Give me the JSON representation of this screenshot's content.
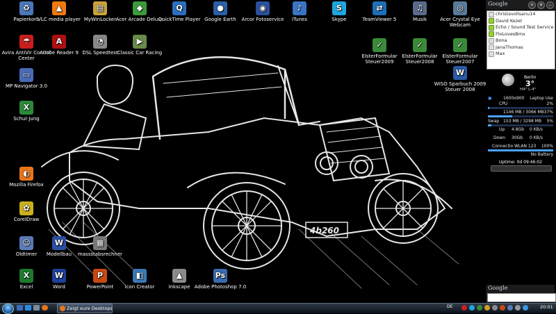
{
  "desktop_icons": [
    {
      "label": "Papierkorb",
      "icon": "recycle-bin-icon",
      "color": "#4a78b8"
    },
    {
      "label": "VLC media player",
      "icon": "vlc-cone-icon",
      "color": "#f07a10"
    },
    {
      "label": "MyWinLocker",
      "icon": "lock-icon",
      "color": "#c9a23a"
    },
    {
      "label": "Acer Arcade Deluxe",
      "icon": "arcade-icon",
      "color": "#3c9b3c"
    },
    {
      "label": "QuickTime Player",
      "icon": "quicktime-icon",
      "color": "#2b6fc2"
    },
    {
      "label": "Google Earth",
      "icon": "globe-icon",
      "color": "#2c5fa8"
    },
    {
      "label": "Arcor Fotoservice",
      "icon": "camera-badge-icon",
      "color": "#2a4f9e"
    },
    {
      "label": "iTunes",
      "icon": "music-note-icon",
      "color": "#3a74c4"
    },
    {
      "label": "Skype",
      "icon": "skype-icon",
      "color": "#1ea6e0"
    },
    {
      "label": "TeamViewer 5",
      "icon": "teamviewer-icon",
      "color": "#1c6fb8"
    },
    {
      "label": "Musik",
      "icon": "music-folder-icon",
      "color": "#5a6a8a"
    },
    {
      "label": "Acer Crystal Eye Webcam",
      "icon": "webcam-icon",
      "color": "#5a7a9a"
    },
    {
      "label": "Avira AntiVir Control Center",
      "icon": "umbrella-icon",
      "color": "#c81e1e"
    },
    {
      "label": "Adobe Reader 9",
      "icon": "pdf-icon",
      "color": "#b01010"
    },
    {
      "label": "DSL Speedtest",
      "icon": "speedometer-icon",
      "color": "#888888"
    },
    {
      "label": "Classic Car Racing",
      "icon": "racing-car-icon",
      "color": "#6a8a4a"
    },
    {
      "label": "ElsterFormular Steuer2009",
      "icon": "tax-form-icon",
      "color": "#3a8a3a"
    },
    {
      "label": "ElsterFormular Steuer2008",
      "icon": "tax-form-icon",
      "color": "#3a8a3a"
    },
    {
      "label": "ElsterFormular Steuer2007",
      "icon": "tax-form-icon",
      "color": "#3a8a3a"
    },
    {
      "label": "MP Navigator 3.0",
      "icon": "scanner-icon",
      "color": "#4a6ab8"
    },
    {
      "label": "WISO Sparbuch 2009 Steuer 2008",
      "icon": "wiso-icon",
      "color": "#2a5aa8"
    },
    {
      "label": "Schul-Jung",
      "icon": "excel-doc-icon",
      "color": "#2a8a3a"
    },
    {
      "label": "Mozilla Firefox",
      "icon": "firefox-icon",
      "color": "#e8741c"
    },
    {
      "label": "CorelDraw",
      "icon": "coreldraw-icon",
      "color": "#c8b020"
    },
    {
      "label": "Oldtimer",
      "icon": "user-folder-icon",
      "color": "#5a7ab8"
    },
    {
      "label": "Modellbau",
      "icon": "word-doc-icon",
      "color": "#2a4fa0"
    },
    {
      "label": "massstabsrechner",
      "icon": "calculator-icon",
      "color": "#7a7a7a"
    },
    {
      "label": "Excel",
      "icon": "excel-icon",
      "color": "#1e7a2e"
    },
    {
      "label": "Word",
      "icon": "word-icon",
      "color": "#1e3f9a"
    },
    {
      "label": "PowerPoint",
      "icon": "powerpoint-icon",
      "color": "#c84a10"
    },
    {
      "label": "Icon Creator",
      "icon": "icon-creator-icon",
      "color": "#3a7ab8"
    },
    {
      "label": "Inkscape",
      "icon": "inkscape-icon",
      "color": "#8a8a8a"
    },
    {
      "label": "Adobe Photoshop 7.0",
      "icon": "photoshop-icon",
      "color": "#3a6ab0"
    }
  ],
  "sidebar": {
    "top_logo": "Google",
    "contacts": [
      {
        "name": "christavollsanu14",
        "online": false
      },
      {
        "name": "David Kezel",
        "online": true
      },
      {
        "name": "Echo / Sound Test Service",
        "online": true
      },
      {
        "name": "FloLovesBmx",
        "online": true
      },
      {
        "name": "Bona",
        "online": false
      },
      {
        "name": "JanaThomas",
        "online": false
      },
      {
        "name": "Max",
        "online": false
      }
    ],
    "weather": {
      "city": "Berlin",
      "temp": "3°",
      "range": "H4° L-4°"
    },
    "meter": {
      "cpu_label": "CPU",
      "cpu_freq": "1600x900",
      "cpu_mode": "Laptop Use",
      "cpu_pct": "2%",
      "cpu_value": 2,
      "ram_text": "1146 MB / 3066 MB",
      "ram_pct": "37%",
      "ram_value": 37,
      "swap_label": "Swap",
      "swap_text": "153 MB / 3298 MB",
      "swap_pct": "5%",
      "swap_value": 5,
      "up_label": "Up",
      "up_total": "4.8Gb",
      "up_rate": "0 KB/s",
      "down_label": "Down",
      "down_total": "30Gb",
      "down_rate": "0 KB/s",
      "net_label": "Connectio",
      "net_name": "WLAN 123",
      "net_pct": "100%",
      "net_value": 100,
      "battery_text": "No Battery",
      "uptime": "Uptime: 0d 09:46:02"
    },
    "search_logo": "Google",
    "search_value": ""
  },
  "taskbar": {
    "active_window": "Zeigt eure Desktops ...",
    "language": "DE",
    "clock": "20:01",
    "accent": "#2f3a48"
  }
}
